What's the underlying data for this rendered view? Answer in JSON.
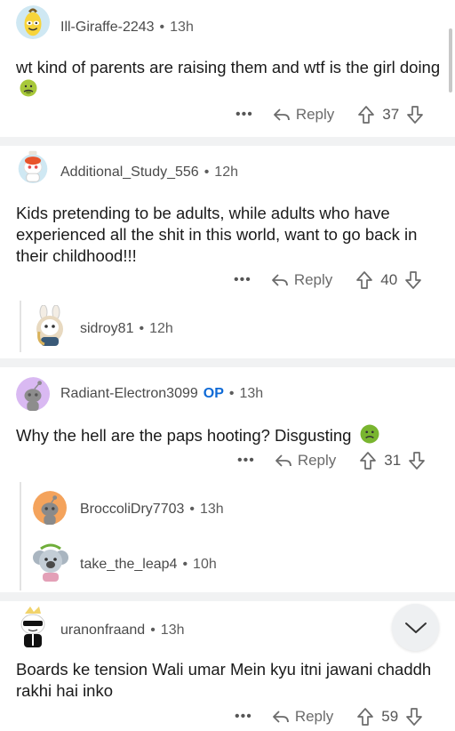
{
  "comments": [
    {
      "username": "Ill-Giraffe-2243",
      "time": "13h",
      "text": "wt kind of parents are raising them and wtf is the girl doing",
      "emoji": "nauseated-face",
      "reply_label": "Reply",
      "votes": "37"
    },
    {
      "username": "Additional_Study_556",
      "time": "12h",
      "text": "Kids pretending to be adults, while adults who have experienced all the shit in this world, want to go back in their childhood!!!",
      "reply_label": "Reply",
      "votes": "40",
      "replies": [
        {
          "username": "sidroy81",
          "time": "12h"
        }
      ]
    },
    {
      "username": "Radiant-Electron3099",
      "op_badge": "OP",
      "time": "13h",
      "text": "Why the hell are the paps hooting? Disgusting",
      "emoji": "nauseated-face",
      "reply_label": "Reply",
      "votes": "31",
      "replies": [
        {
          "username": "BroccoliDry7703",
          "time": "13h"
        },
        {
          "username": "take_the_leap4",
          "time": "10h"
        }
      ]
    },
    {
      "username": "uranonfraand",
      "time": "13h",
      "text": "Boards ke tension Wali umar Mein kyu itni jawani chaddh rakhi hai inko",
      "reply_label": "Reply",
      "votes": "59"
    }
  ],
  "more_label": "•••",
  "dot": "•",
  "icons": {
    "reply": "reply-arrow-icon",
    "upvote": "upvote-arrow-icon",
    "downvote": "downvote-arrow-icon",
    "more": "more-options-icon",
    "collapse": "chevron-down-icon"
  }
}
